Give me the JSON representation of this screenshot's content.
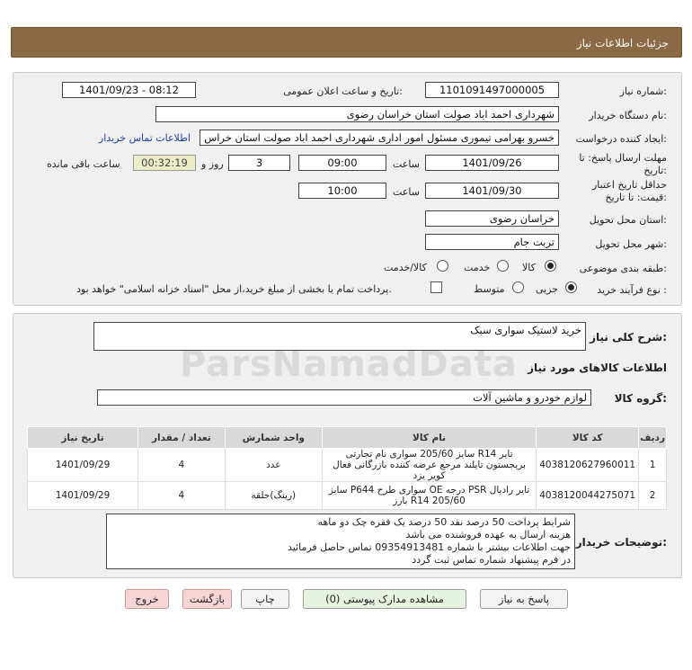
{
  "header": {
    "title": "جزئیات اطلاعات نیاز"
  },
  "form": {
    "need_number_label": "شماره نیاز:",
    "need_number": "1101091497000005",
    "announce_label": "تاریخ و ساعت اعلان عمومی:",
    "announce_value": "1401/09/23 - 08:12",
    "buyer_org_label": "نام دستگاه خریدار:",
    "buyer_org": "شهرداری احمد اباد صولت استان خراسان رضوی",
    "creator_label": "ایجاد کننده درخواست:",
    "creator": "خسرو بهرامی تیموری مسئول امور اداری شهرداری احمد اباد صولت استان خراس",
    "contact_link": "اطلاعات تماس خریدار",
    "deadline_label": "مهلت ارسال پاسخ: تا تاریخ:",
    "deadline_date": "1401/09/26",
    "time_label": "ساعت",
    "deadline_time": "09:00",
    "days_value": "3",
    "days_label": "روز و",
    "remaining_time": "00:32:19",
    "remaining_label": "ساعت باقی مانده",
    "validity_label": "حداقل تاریخ اعتبار قیمت: تا تاریخ:",
    "validity_date": "1401/09/30",
    "validity_time": "10:00",
    "province_label": "استان محل تحویل:",
    "province": "خراسان رضوی",
    "city_label": "شهر محل تحویل:",
    "city": "تربت جام",
    "category_label": "طبقه بندی موضوعی:",
    "category_options": [
      "کالا",
      "خدمت",
      "کالا/خدمت"
    ],
    "process_label": "نوع فرآیند خرید :",
    "process_options": [
      "جزیی",
      "متوسط"
    ],
    "payment_note": "پرداخت تمام یا بخشی از مبلغ خرید،از محل \"اسناد خزانه اسلامی\" خواهد بود."
  },
  "desc": {
    "general_label": "شرح کلی نیاز:",
    "general_value": "خرید لاستیک سواری سبک",
    "goods_info_title": "اطلاعات کالاهای مورد نیاز",
    "group_label": "گروه کالا:",
    "group_value": "لوازم خودرو و ماشین آلات"
  },
  "table": {
    "headers": [
      "ردیف",
      "کد کالا",
      "نام کالا",
      "واحد شمارش",
      "تعداد / مقدار",
      "تاریخ نیاز"
    ],
    "rows": [
      {
        "idx": "1",
        "code": "4038120627960011",
        "name": "تایر R14 سایز 205/60 سواری نام تجارتی بریجستون تایلند مرجع عرضه کننده بازرگانی فعال کویر یزد",
        "unit": "عدد",
        "qty": "4",
        "date": "1401/09/29"
      },
      {
        "idx": "2",
        "code": "4038120044275071",
        "name": "تایر رادیال PSR درجه OE سواری طرح P644 سایز 205/60 R14 بارز",
        "unit": "(رینگ)حلقه",
        "qty": "4",
        "date": "1401/09/29"
      }
    ]
  },
  "notes": {
    "label": "توضیحات خریدار:",
    "lines": [
      "شرایط پرداخت 50 درصد نقد 50 درصد یک فقره چک دو ماهه",
      "هزینه ارسال به عهده فروشنده می باشد",
      "جهت اطلاعات بیشتر با شماره 09354913481 تماس حاصل فرمائید",
      "در فرم پیشنهاد شماره تماس ثبت گردد"
    ]
  },
  "buttons": {
    "reply": "پاسخ به نیاز",
    "docs": "مشاهده مدارک پیوستی (0)",
    "print": "چاپ",
    "back": "بازگشت",
    "exit": "خروج"
  },
  "watermark": "ParsNamadData"
}
